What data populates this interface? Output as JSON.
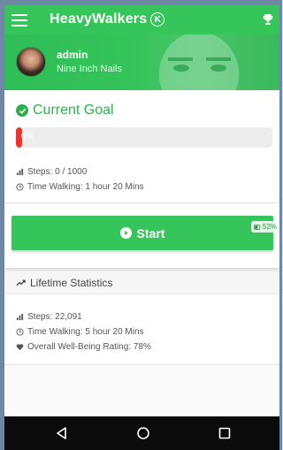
{
  "appbar": {
    "title": "HeavyWalkers",
    "brand_mark": "K",
    "menu_icon": "hamburger-menu-icon",
    "trophy_icon": "trophy-icon"
  },
  "profile": {
    "username": "admin",
    "band": "Nine Inch Nails"
  },
  "current_goal": {
    "title": "Current Goal",
    "progress_text": "0%",
    "progress_fraction": 0.0,
    "steps": "Steps: 0 / 1000",
    "time_walking": "Time Walking: 1 hour 20 Mins"
  },
  "start": {
    "label": "Start",
    "battery_text": "52%"
  },
  "lifetime": {
    "title": "Lifetime Statistics",
    "steps": "Steps: 22,091",
    "time_walking": "Time Walking: 5 hour 20 Mins",
    "wellbeing": "Overall Well-Being Rating: 78%"
  },
  "colors": {
    "primary": "#35c55a",
    "goal_green": "#2eae4f",
    "progress_red": "#e3382f",
    "navbar": "#0b0b0b"
  },
  "navbar": {
    "back_icon": "back-triangle-icon",
    "home_icon": "home-circle-icon",
    "recents_icon": "recents-square-icon"
  }
}
